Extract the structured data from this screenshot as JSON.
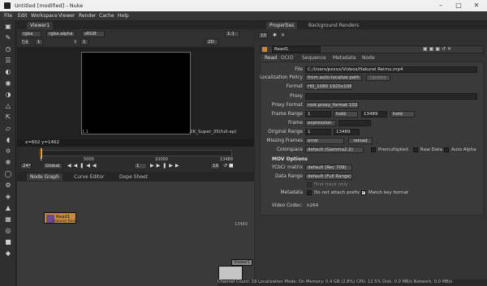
{
  "window": {
    "title": "Untitled [modified] - Nuke"
  },
  "menu": [
    "File",
    "Edit",
    "Workspace",
    "Viewer",
    "Render",
    "Cache",
    "Help"
  ],
  "viewer": {
    "tab": "Viewer1",
    "channels": "rgba",
    "layer": "rgba.alpha",
    "colorspace": "sRGB",
    "zoom": "1:1",
    "mode": "2D",
    "fstop": "f/8",
    "gain": "1",
    "y_label": "Y",
    "y_value": "1",
    "format_label": "2K_Super_35(full-ap)",
    "corner_label": "1,1",
    "coords": "x=602 y=1462"
  },
  "timeline": {
    "start": "1",
    "tick1": "5000",
    "tick2": "10000",
    "end": "13489",
    "fps": "24*",
    "scope": "Global",
    "current_frame": "1",
    "step": "10"
  },
  "lower_tabs": [
    "Node Graph",
    "Curve Editor",
    "Dope Sheet"
  ],
  "nodes": {
    "read_label": "Read1",
    "read_sub": "Hakurei Reimu",
    "viewer_label": "Viewer1",
    "marker": "13489"
  },
  "properties": {
    "tabs": [
      "Properties",
      "Background Renders"
    ],
    "count": "10",
    "node_name": "Read1",
    "subtabs": [
      "Read",
      "OCIO",
      "Sequence",
      "Metadata",
      "Node"
    ],
    "file_label": "File",
    "file_value": "C:/Users/pxxxx/Videos/Hakurei Reimu.mp4",
    "localization_label": "Localization Policy",
    "localization_value": "from auto-localize path",
    "update_button": "Update",
    "format_label": "Format",
    "format_value": "HD_1080 1920x1080",
    "proxy_label": "Proxy",
    "proxy_format_label": "Proxy Format",
    "proxy_format_value": "root.proxy_format 1024x778",
    "frame_range_label": "Frame Range",
    "frame_range_start": "1",
    "frame_range_start_mode": "hold",
    "frame_range_end": "13489",
    "frame_range_end_mode": "hold",
    "frame_label": "Frame",
    "frame_value": "expression",
    "original_range_label": "Original Range",
    "original_range_start": "1",
    "original_range_end": "13489",
    "missing_frames_label": "Missing Frames",
    "missing_frames_value": "error",
    "reload_button": "reload",
    "colorspace_label": "Colorspace",
    "colorspace_value": "default (Gamma2.2)",
    "premultiplied": "Premultiplied",
    "raw_data": "Raw Data",
    "auto_alpha": "Auto Alpha",
    "mov_section": "MOV Options",
    "ycbcr_label": "YCbCr matrix",
    "ycbcr_value": "default (Rec 709)",
    "data_range_label": "Data Range",
    "data_range_value": "default (Full Range)",
    "first_track_only": "First track only",
    "metadata_label": "Metadata",
    "do_not_attach": "Do not attach prefix",
    "match_key": "Match key format",
    "video_codec_label": "Video Codec:",
    "video_codec_value": "h264"
  },
  "status": "Channel Count: 19  Localization Mode: On  Memory: 0.4 GB (2.8%)  CPU: 12.5%  Disk: 0.0 MB/s  Network: 0.0 MB/s"
}
